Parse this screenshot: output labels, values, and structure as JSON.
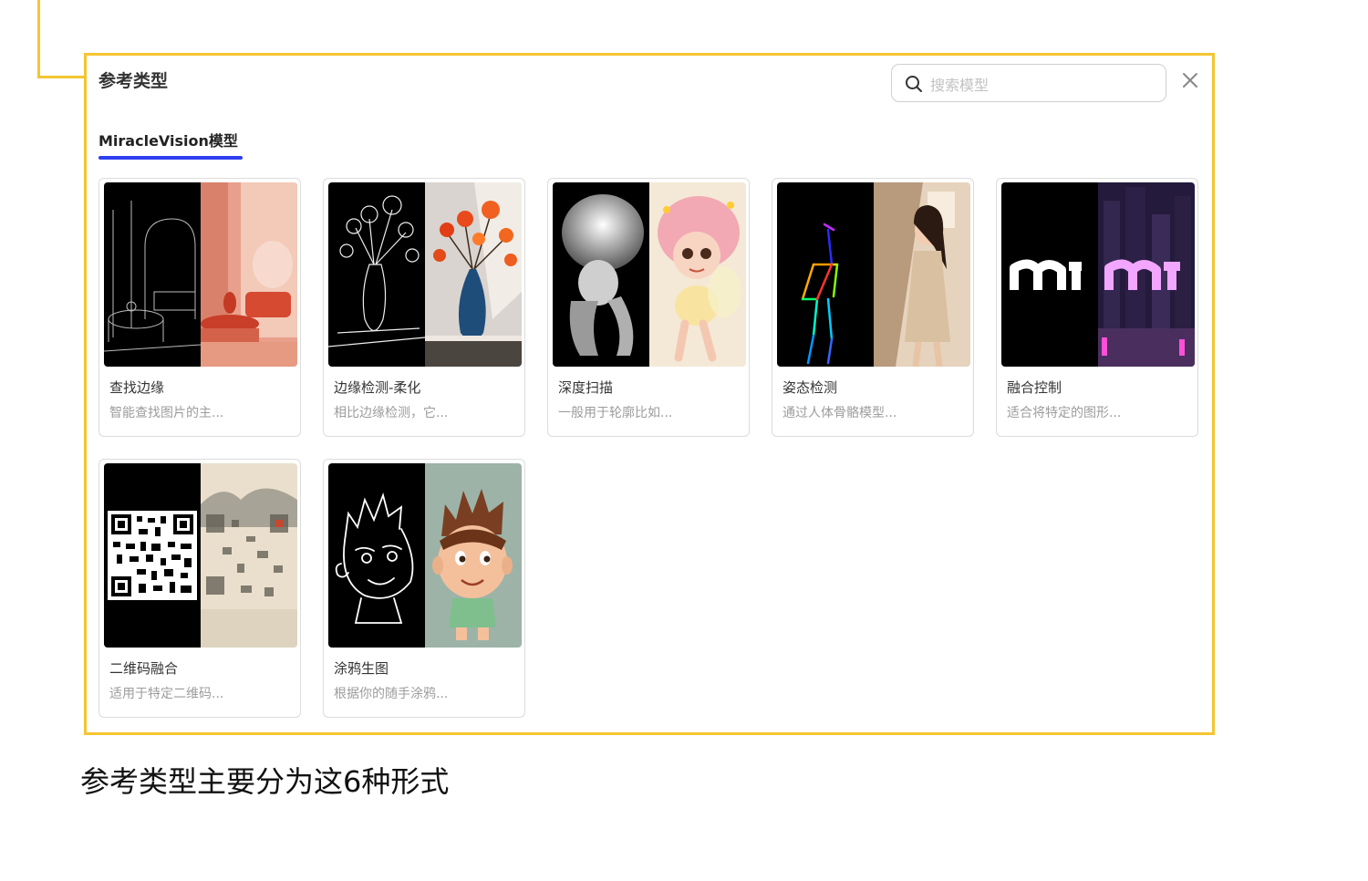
{
  "panel": {
    "title": "参考类型",
    "search_placeholder": "搜索模型",
    "tab_label": "MiracleVision模型",
    "accent_color": "#2e3ff0",
    "frame_color": "#f5c531"
  },
  "cards": [
    {
      "title": "查找边缘",
      "desc": "智能查找图片的主..."
    },
    {
      "title": "边缘检测-柔化",
      "desc": "相比边缘检测，它..."
    },
    {
      "title": "深度扫描",
      "desc": "一般用于轮廓比如..."
    },
    {
      "title": "姿态检测",
      "desc": "通过人体骨骼模型..."
    },
    {
      "title": "融合控制",
      "desc": "适合将特定的图形..."
    },
    {
      "title": "二维码融合",
      "desc": "适用于特定二维码..."
    },
    {
      "title": "涂鸦生图",
      "desc": "根据你的随手涂鸦..."
    }
  ],
  "caption": "参考类型主要分为这6种形式"
}
